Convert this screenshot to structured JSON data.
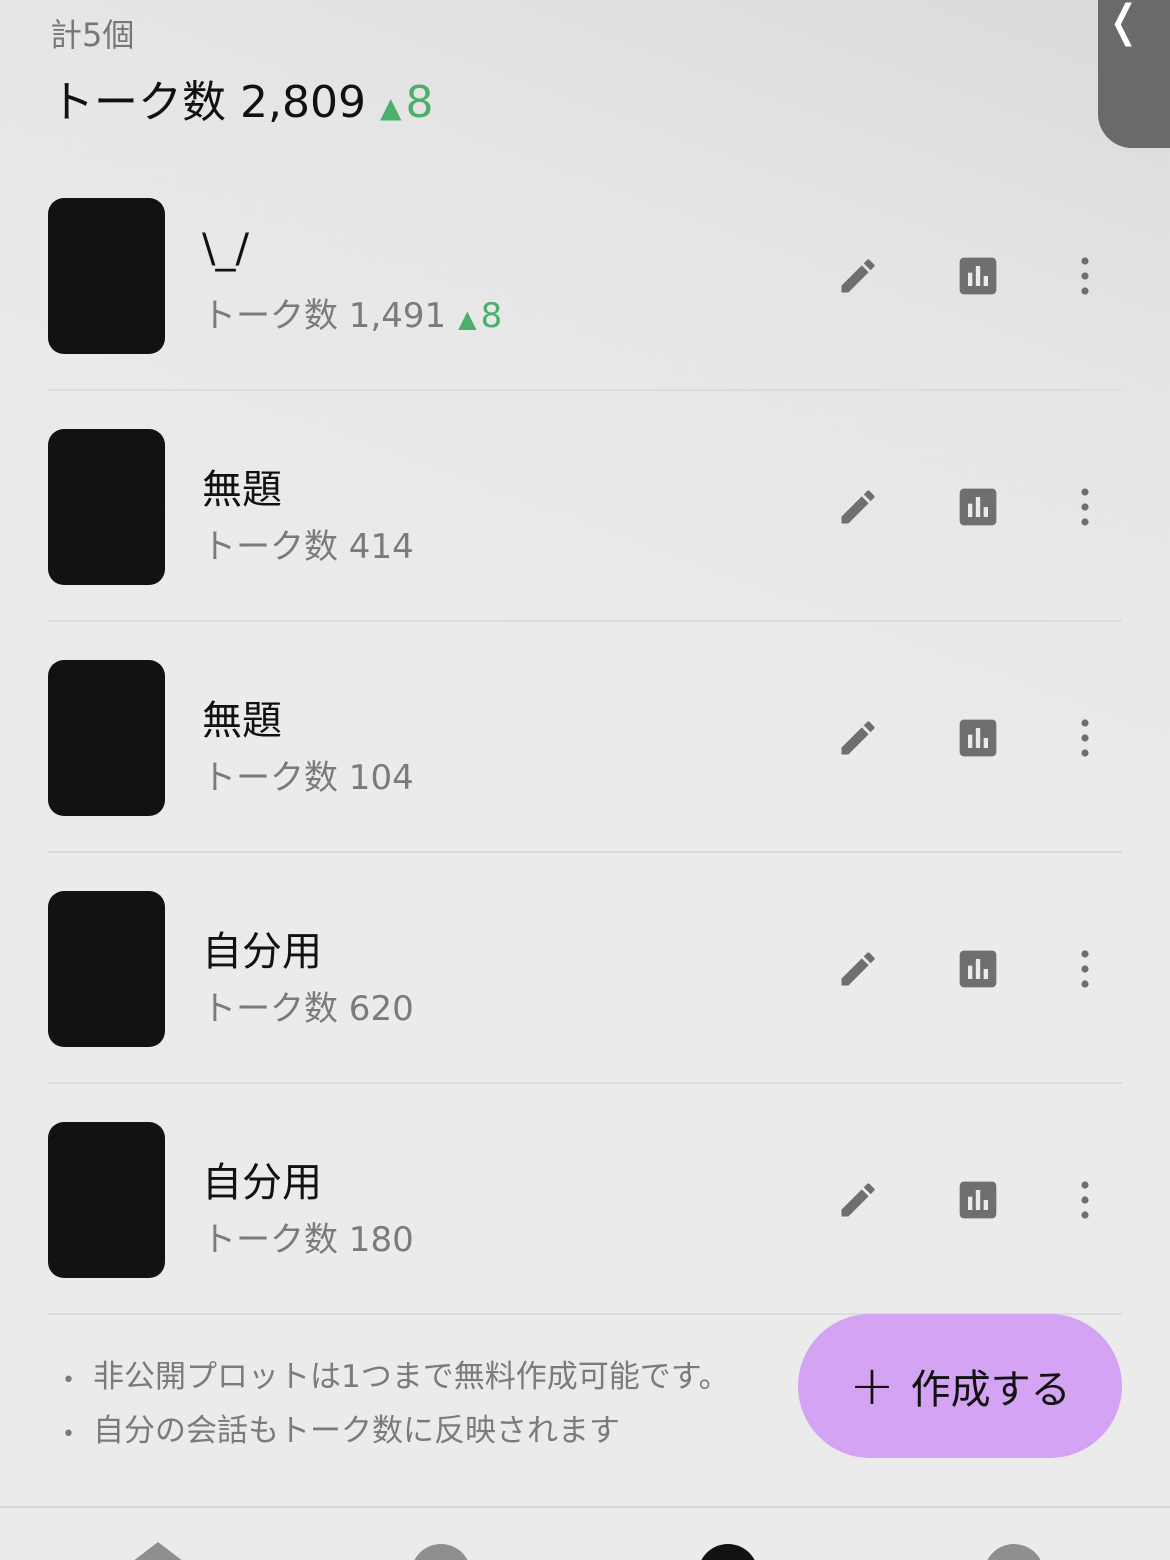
{
  "header": {
    "count_label": "計5個",
    "total_label": "トーク数 2,809",
    "total_delta_arrow": "▲",
    "total_delta": "8"
  },
  "items": [
    {
      "title": "\\_/",
      "sub": "トーク数 1,491",
      "delta_arrow": "▲",
      "delta": "8"
    },
    {
      "title": "無題",
      "sub": "トーク数 414"
    },
    {
      "title": "無題",
      "sub": "トーク数 104"
    },
    {
      "title": "自分用",
      "sub": "トーク数 620"
    },
    {
      "title": "自分用",
      "sub": "トーク数 180"
    }
  ],
  "notes": [
    "非公開プロットは1つまで無料作成可能です。",
    "自分の会話もトーク数に反映されます"
  ],
  "note_bullet": "•",
  "fab": {
    "plus": "+",
    "label": "作成する"
  },
  "side_tab": {
    "chevron": "❬"
  },
  "icons": {
    "edit": "pencil-icon",
    "stats": "bar-chart-icon",
    "more": "more-vertical-icon"
  },
  "colors": {
    "accent": "#d4a3f3",
    "up": "#4caf6e",
    "icon": "#6f6f6f"
  }
}
